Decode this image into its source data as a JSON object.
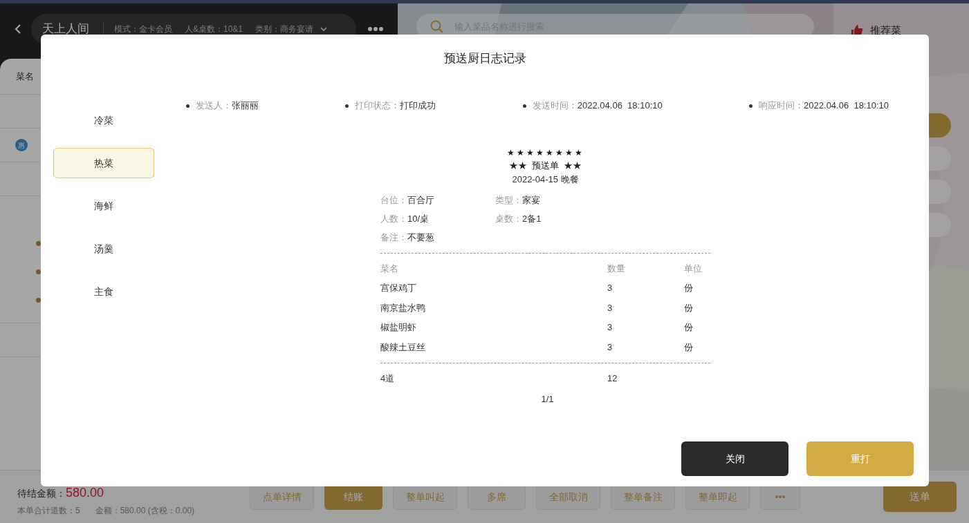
{
  "header": {
    "title": "天上人间",
    "mode_label": "模式：",
    "mode": "金卡会员",
    "guests_label": "人&桌数：",
    "guests": "10&1",
    "category_label": "类别：",
    "category": "商务宴请"
  },
  "search": {
    "placeholder": "输入菜品名称进行搜索"
  },
  "recommend": {
    "label": "推荐菜"
  },
  "side_pills": [
    {
      "selected": true
    },
    {
      "selected": false
    },
    {
      "selected": false
    },
    {
      "selected": false
    }
  ],
  "order_list": {
    "column": "菜名",
    "rows": [
      {
        "kind": "plain"
      },
      {
        "kind": "promo",
        "badge": "惠"
      },
      {
        "kind": "plain"
      },
      {
        "kind": "group",
        "children": [
          {
            "kind": "sub"
          },
          {
            "kind": "sub"
          },
          {
            "kind": "sub"
          }
        ]
      },
      {
        "kind": "plain"
      }
    ]
  },
  "footer": {
    "due_label": "待结金额：",
    "due_amount": "580.00",
    "count_label": "本单合计道数：",
    "count": "5",
    "amount_label": "金额：",
    "amount": "580.00 (含税：0.00)",
    "buttons": [
      {
        "label": "点单详情",
        "primary": false
      },
      {
        "label": "结账",
        "primary": true
      },
      {
        "label": "整单叫起",
        "primary": false
      },
      {
        "label": "多席",
        "primary": false
      },
      {
        "label": "全部取消",
        "primary": false
      },
      {
        "label": "整单备注",
        "primary": false
      },
      {
        "label": "整单即起",
        "primary": false
      },
      {
        "label": "•••",
        "primary": false
      }
    ],
    "send_button": "送单"
  },
  "dialog": {
    "title": "预送厨日志记录",
    "categories": [
      {
        "label": "冷菜",
        "selected": false
      },
      {
        "label": "热菜",
        "selected": true
      },
      {
        "label": "海鲜",
        "selected": false
      },
      {
        "label": "汤羹",
        "selected": false
      },
      {
        "label": "主食",
        "selected": false
      }
    ],
    "info": [
      {
        "label": "发送人：",
        "value": "张丽丽"
      },
      {
        "label": "打印状态：",
        "value": "打印成功"
      },
      {
        "label": "发送时间：",
        "value": "2022.04.06  18:10:10"
      },
      {
        "label": "响应时间：",
        "value": "2022.04.06  18:10:10"
      }
    ],
    "receipt": {
      "stars": "★★★★★★★★",
      "title": "★★  预送单  ★★",
      "date": "2022-04-15 晚餐",
      "fields": [
        {
          "label": "台位：",
          "value": "百合厅"
        },
        {
          "label": "类型：",
          "value": "家宴"
        },
        {
          "label": "人数：",
          "value": "10/桌"
        },
        {
          "label": "桌数：",
          "value": "2备1"
        },
        {
          "label": "备注：",
          "value": "不要葱"
        }
      ],
      "columns": [
        "菜名",
        "数量",
        "单位"
      ],
      "rows": [
        [
          "宫保鸡丁",
          "3",
          "份"
        ],
        [
          "南京盐水鸭",
          "3",
          "份"
        ],
        [
          "椒盐明虾",
          "3",
          "份"
        ],
        [
          "酸辣土豆丝",
          "3",
          "份"
        ]
      ],
      "total": [
        "4道",
        "12"
      ],
      "page": "1/1"
    },
    "buttons": [
      {
        "label": "关闭",
        "kind": "secondary"
      },
      {
        "label": "重打",
        "kind": "primary"
      }
    ]
  }
}
